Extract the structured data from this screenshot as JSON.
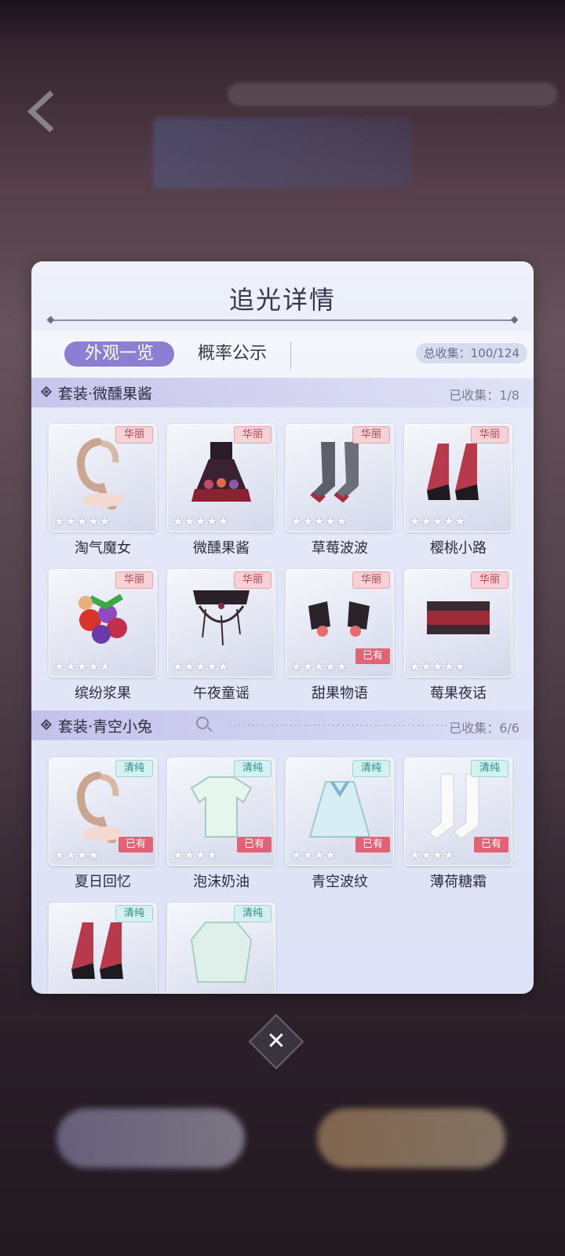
{
  "panel": {
    "title": "追光详情",
    "tabs": [
      {
        "label": "外观一览",
        "active": true
      },
      {
        "label": "概率公示",
        "active": false
      }
    ],
    "total_collect": "总收集：100/124"
  },
  "sections": [
    {
      "title": "套装·微醺果酱",
      "count": "已收集：1/8",
      "items": [
        {
          "name": "淘气魔女",
          "rarity": "华丽",
          "stars": "★★★★★",
          "owned": "",
          "art": "hair-icon"
        },
        {
          "name": "微醺果酱",
          "rarity": "华丽",
          "stars": "★★★★★",
          "owned": "",
          "art": "dress-icon"
        },
        {
          "name": "草莓波波",
          "rarity": "华丽",
          "stars": "★★★★★",
          "owned": "",
          "art": "socks-icon"
        },
        {
          "name": "樱桃小路",
          "rarity": "华丽",
          "stars": "★★★★★",
          "owned": "",
          "art": "shoes-icon"
        },
        {
          "name": "缤纷浆果",
          "rarity": "华丽",
          "stars": "★★★★★",
          "owned": "",
          "art": "fruit-icon"
        },
        {
          "name": "午夜童谣",
          "rarity": "华丽",
          "stars": "★★★★★",
          "owned": "",
          "art": "necklace-icon"
        },
        {
          "name": "甜果物语",
          "rarity": "华丽",
          "stars": "★★★★★",
          "owned": "已有",
          "art": "gloves-icon"
        },
        {
          "name": "莓果夜话",
          "rarity": "华丽",
          "stars": "★★★★★",
          "owned": "",
          "art": "choker-icon"
        }
      ]
    },
    {
      "title": "套装·青空小兔",
      "count": "已收集：6/6",
      "items": [
        {
          "name": "夏日回忆",
          "rarity": "清纯",
          "stars": "★★★★",
          "owned": "已有",
          "art": "hair-icon"
        },
        {
          "name": "泡沫奶油",
          "rarity": "清纯",
          "stars": "★★★★",
          "owned": "已有",
          "art": "shirt-icon"
        },
        {
          "name": "青空波纹",
          "rarity": "清纯",
          "stars": "★★★★",
          "owned": "已有",
          "art": "skirt-icon"
        },
        {
          "name": "薄荷糖霜",
          "rarity": "清纯",
          "stars": "★★★★",
          "owned": "已有",
          "art": "stockings-icon"
        },
        {
          "name": "",
          "rarity": "清纯",
          "stars": "",
          "owned": "",
          "art": "shoes-icon"
        },
        {
          "name": "",
          "rarity": "清纯",
          "stars": "",
          "owned": "",
          "art": "jacket-icon"
        }
      ]
    }
  ],
  "colors": {
    "accent": "#8a7fd2",
    "owned_badge": "#e36275",
    "gorgeous_badge": "#f6d1d6",
    "pure_badge": "#d4f0ef"
  },
  "close_button": {
    "icon": "close-icon",
    "glyph": "✕"
  }
}
